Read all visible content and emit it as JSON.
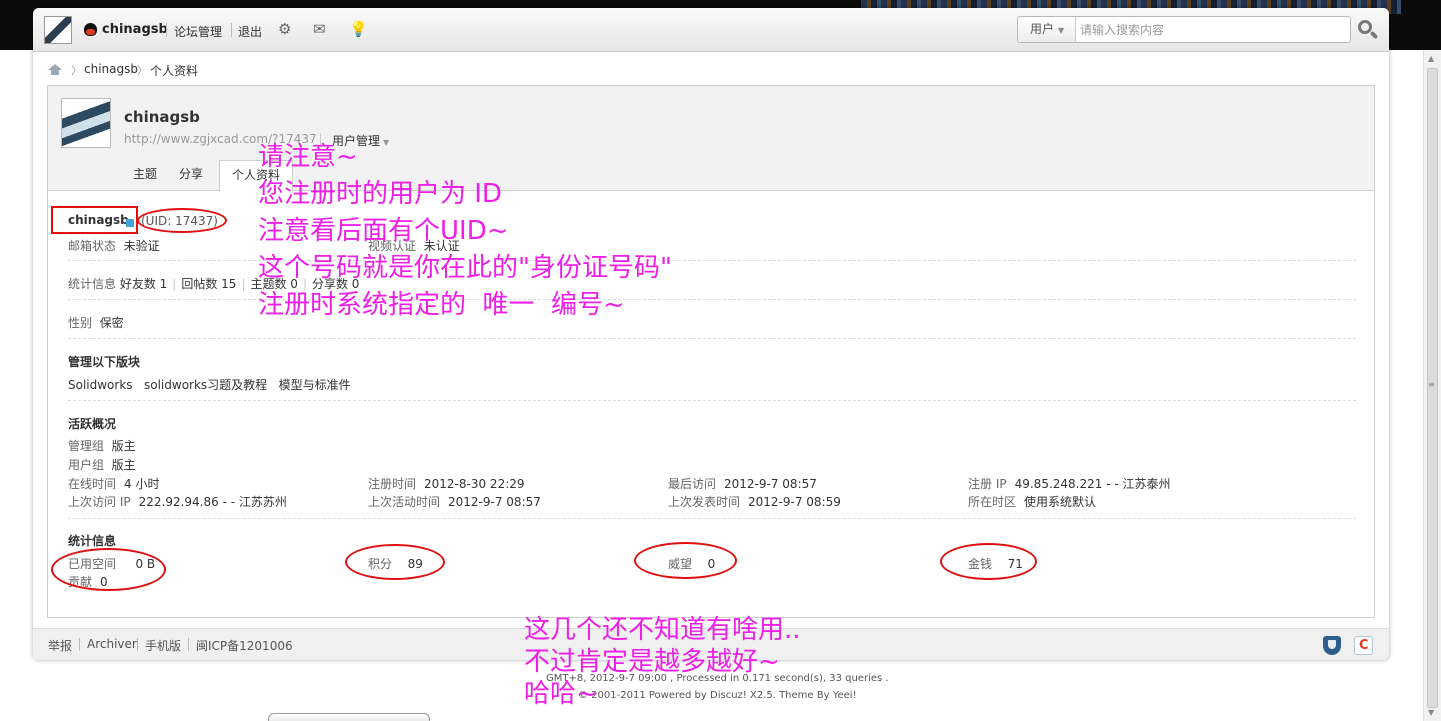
{
  "toolbar": {
    "username": "chinagsb",
    "forum_manage": "论坛管理",
    "logout": "退出",
    "icons": [
      "gear-icon",
      "mail-icon",
      "bulb-icon"
    ],
    "search_type": "用户",
    "search_placeholder": "请输入搜索内容"
  },
  "breadcrumb": [
    "chinagsb",
    "个人资料"
  ],
  "profile": {
    "name": "chinagsb",
    "url": "http://www.zgjxcad.com/?17437",
    "manage": "用户管理",
    "tabs": [
      "主题",
      "分享",
      "个人资料"
    ],
    "active_tab": "个人资料",
    "uid": "(UID: 17437)"
  },
  "info": {
    "email_label": "邮箱状态",
    "email_value": "未验证",
    "video_label": "视频认证",
    "video_value": "未认证",
    "stats_label": "统计信息",
    "friends": "好友数 1",
    "replies": "回帖数 15",
    "threads": "主题数 0",
    "shares": "分享数 0",
    "gender_label": "性别",
    "gender_value": "保密"
  },
  "manage_section": {
    "title": "管理以下版块",
    "forums": [
      "Solidworks",
      "solidworks习题及教程",
      "模型与标准件"
    ]
  },
  "activity": {
    "title": "活跃概况",
    "admin_group_label": "管理组",
    "admin_group_value": "版主",
    "user_group_label": "用户组",
    "user_group_value": "版主",
    "online_label": "在线时间",
    "online_value": "4 小时",
    "reg_time_label": "注册时间",
    "reg_time_value": "2012-8-30 22:29",
    "last_visit_label": "最后访问",
    "last_visit_value": "2012-9-7 08:57",
    "reg_ip_label": "注册 IP",
    "reg_ip_value": "49.85.248.221 - - 江苏泰州",
    "last_ip_label": "上次访问 IP",
    "last_ip_value": "222.92.94.86 - - 江苏苏州",
    "last_active_label": "上次活动时间",
    "last_active_value": "2012-9-7 08:57",
    "last_post_label": "上次发表时间",
    "last_post_value": "2012-9-7 08:59",
    "timezone_label": "所在时区",
    "timezone_value": "使用系统默认"
  },
  "stats": {
    "title": "统计信息",
    "space_label": "已用空间",
    "space_value": "0 B",
    "contrib_label": "贡献",
    "contrib_value": "0",
    "points_label": "积分",
    "points_value": "89",
    "prestige_label": "威望",
    "prestige_value": "0",
    "money_label": "金钱",
    "money_value": "71"
  },
  "footer": {
    "links": [
      "举报",
      "Archiver",
      "手机版",
      "闽ICP备1201006"
    ],
    "gmt": "GMT+8, 2012-9-7 09:00 , Processed in 0.171 second(s), 33 queries .",
    "powered": "© 2001-2011 Powered by Discuz! X2.5. Theme By Yeei!"
  },
  "annotations": {
    "note1": [
      "请注意~",
      "您注册时的用户为 ID",
      "注意看后面有个UID~",
      "这个号码就是你在此的\"身份证号码\"",
      "注册时系统指定的  唯一  编号~"
    ],
    "note2": [
      "这几个还不知道有啥用..",
      "不过肯定是越多越好~",
      "哈哈~"
    ],
    "color": "#ee1fe6",
    "mark_color": "#e01010"
  }
}
